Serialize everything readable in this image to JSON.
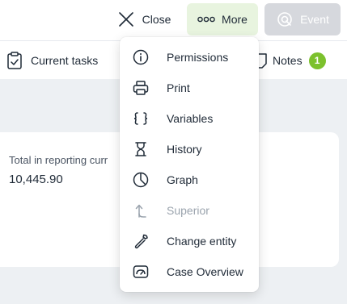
{
  "header": {
    "close_label": "Close",
    "more_label": "More",
    "event_label": "Event"
  },
  "subbar": {
    "current_tasks_label": "Current tasks",
    "notes_label": "Notes",
    "notes_count": "1"
  },
  "card": {
    "label": "Total in reporting curr",
    "value": "10,445.90"
  },
  "menu": {
    "items": [
      {
        "label": "Permissions",
        "icon": "info-icon"
      },
      {
        "label": "Print",
        "icon": "printer-icon"
      },
      {
        "label": "Variables",
        "icon": "braces-icon"
      },
      {
        "label": "History",
        "icon": "hourglass-icon"
      },
      {
        "label": "Graph",
        "icon": "pie-chart-icon"
      },
      {
        "label": "Superior",
        "icon": "arrow-up-icon"
      },
      {
        "label": "Change entity",
        "icon": "wrench-icon"
      },
      {
        "label": "Case Overview",
        "icon": "gauge-icon"
      }
    ]
  },
  "colors": {
    "more_bg": "#e8f4df",
    "event_bg": "#d6d8dd",
    "badge": "#7cc12d",
    "content_bg": "#edf0f3"
  }
}
